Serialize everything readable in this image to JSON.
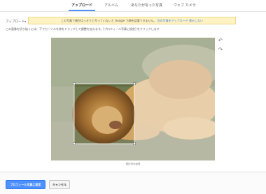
{
  "tabs": [
    {
      "label": "アップロード",
      "active": true
    },
    {
      "label": "アルバム",
      "active": false
    },
    {
      "label": "あなたが写った写真",
      "active": false
    },
    {
      "label": "ウェブ カメラ",
      "active": false
    }
  ],
  "upload": {
    "label": "アップロード",
    "chevron_icon": "chevron-down-icon"
  },
  "notice": {
    "text": "この写真で顔がはっきりと写っていないと Google で顔を認識できません。",
    "link": "別の写真をアップロード",
    "dismiss": "表示しない"
  },
  "instruction": "この画像を切り抜くには、下でカーソルを枠をドラッグして調整を加えます。[プロフィール写真に設定] をクリックします",
  "photo": {
    "name": "lion-photo",
    "accent_color": "#4d90fe"
  },
  "rotate": {
    "left_icon": "rotate-left-icon",
    "right_icon": "rotate-right-icon"
  },
  "caption": "選択済み画像",
  "buttons": {
    "primary": "プロフィール写真に設定",
    "cancel": "キャンセル"
  }
}
